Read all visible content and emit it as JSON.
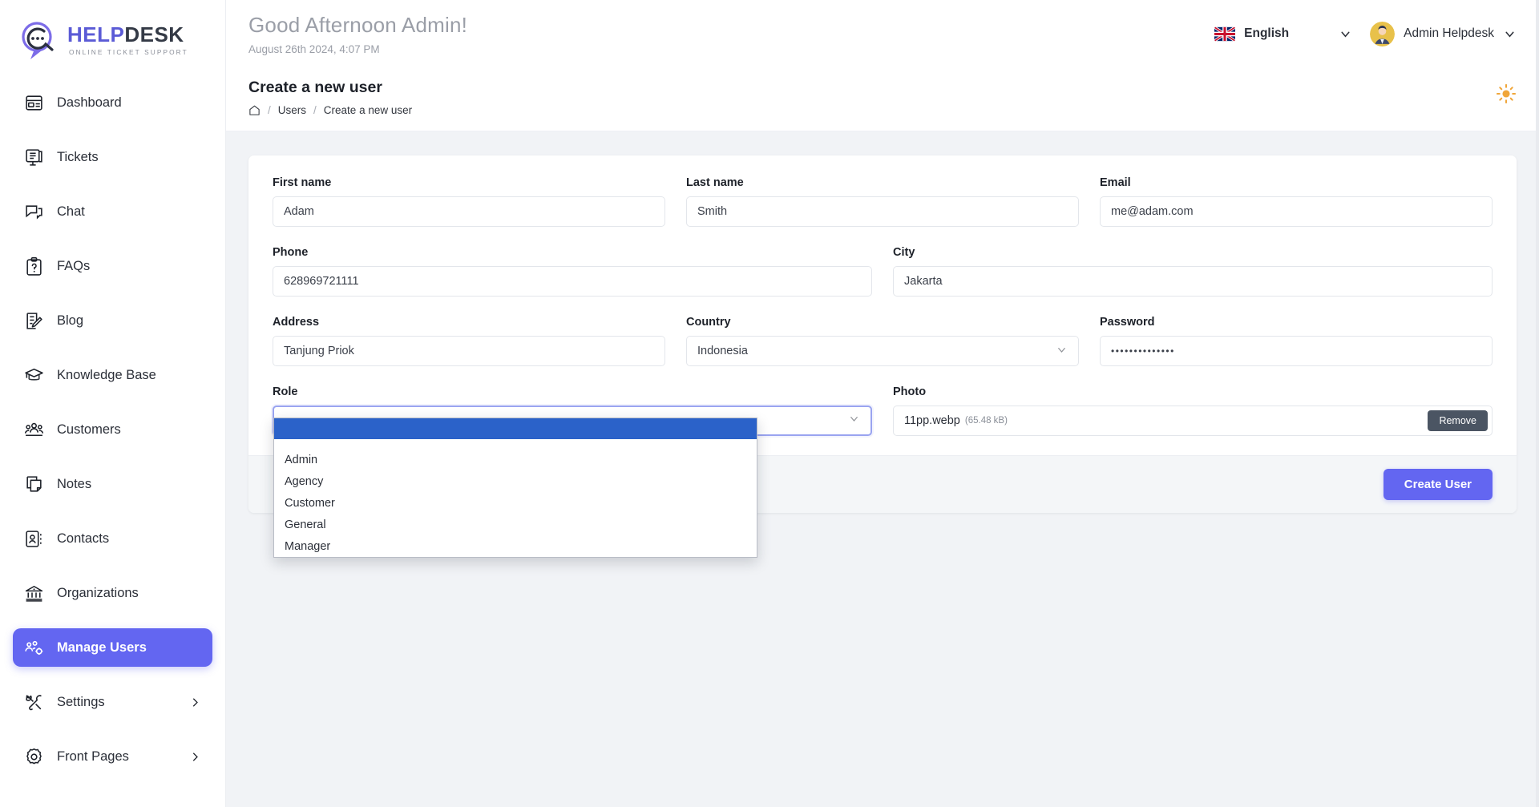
{
  "brand": {
    "name_help": "HELP",
    "name_desk": "DESK",
    "tagline": "ONLINE TICKET SUPPORT"
  },
  "sidebar": {
    "items": [
      {
        "label": "Dashboard",
        "icon": "dashboard-icon",
        "active": false,
        "has_chevron": false
      },
      {
        "label": "Tickets",
        "icon": "ticket-monitor-icon",
        "active": false,
        "has_chevron": false
      },
      {
        "label": "Chat",
        "icon": "chat-bubbles-icon",
        "active": false,
        "has_chevron": false
      },
      {
        "label": "FAQs",
        "icon": "clipboard-question-icon",
        "active": false,
        "has_chevron": false
      },
      {
        "label": "Blog",
        "icon": "note-pencil-icon",
        "active": false,
        "has_chevron": false
      },
      {
        "label": "Knowledge Base",
        "icon": "graduation-cap-icon",
        "active": false,
        "has_chevron": false
      },
      {
        "label": "Customers",
        "icon": "users-group-icon",
        "active": false,
        "has_chevron": false
      },
      {
        "label": "Notes",
        "icon": "notes-icon",
        "active": false,
        "has_chevron": false
      },
      {
        "label": "Contacts",
        "icon": "contact-book-icon",
        "active": false,
        "has_chevron": false
      },
      {
        "label": "Organizations",
        "icon": "bank-icon",
        "active": false,
        "has_chevron": false
      },
      {
        "label": "Manage Users",
        "icon": "users-cog-icon",
        "active": true,
        "has_chevron": false
      },
      {
        "label": "Settings",
        "icon": "tools-icon",
        "active": false,
        "has_chevron": true
      },
      {
        "label": "Front Pages",
        "icon": "gear-icon",
        "active": false,
        "has_chevron": true
      }
    ]
  },
  "topbar": {
    "greeting": "Good Afternoon Admin!",
    "datetime": "August 26th 2024, 4:07 PM",
    "language": "English",
    "user_name": "Admin Helpdesk"
  },
  "page": {
    "title": "Create a new user",
    "breadcrumb": [
      "Users",
      "Create a new user"
    ]
  },
  "form": {
    "first_name": {
      "label": "First name",
      "value": "Adam"
    },
    "last_name": {
      "label": "Last name",
      "value": "Smith"
    },
    "email": {
      "label": "Email",
      "value": "me@adam.com"
    },
    "phone": {
      "label": "Phone",
      "value": "628969721111"
    },
    "city": {
      "label": "City",
      "value": "Jakarta"
    },
    "address": {
      "label": "Address",
      "value": "Tanjung Priok"
    },
    "country": {
      "label": "Country",
      "value": "Indonesia"
    },
    "password": {
      "label": "Password",
      "value": "••••••••••••••"
    },
    "role": {
      "label": "Role",
      "value": "",
      "options": [
        "",
        "Admin",
        "Agency",
        "Customer",
        "General",
        "Manager"
      ],
      "selected_index": 0,
      "open": true
    },
    "photo": {
      "label": "Photo",
      "file_name": "11pp.webp",
      "file_size": "(65.48 kB)",
      "remove_label": "Remove"
    },
    "submit_label": "Create User"
  },
  "colors": {
    "accent": "#6366f1",
    "select_highlight": "#2b62c9",
    "remove_btn": "#4b5563",
    "page_bg": "#f1f3f6"
  }
}
